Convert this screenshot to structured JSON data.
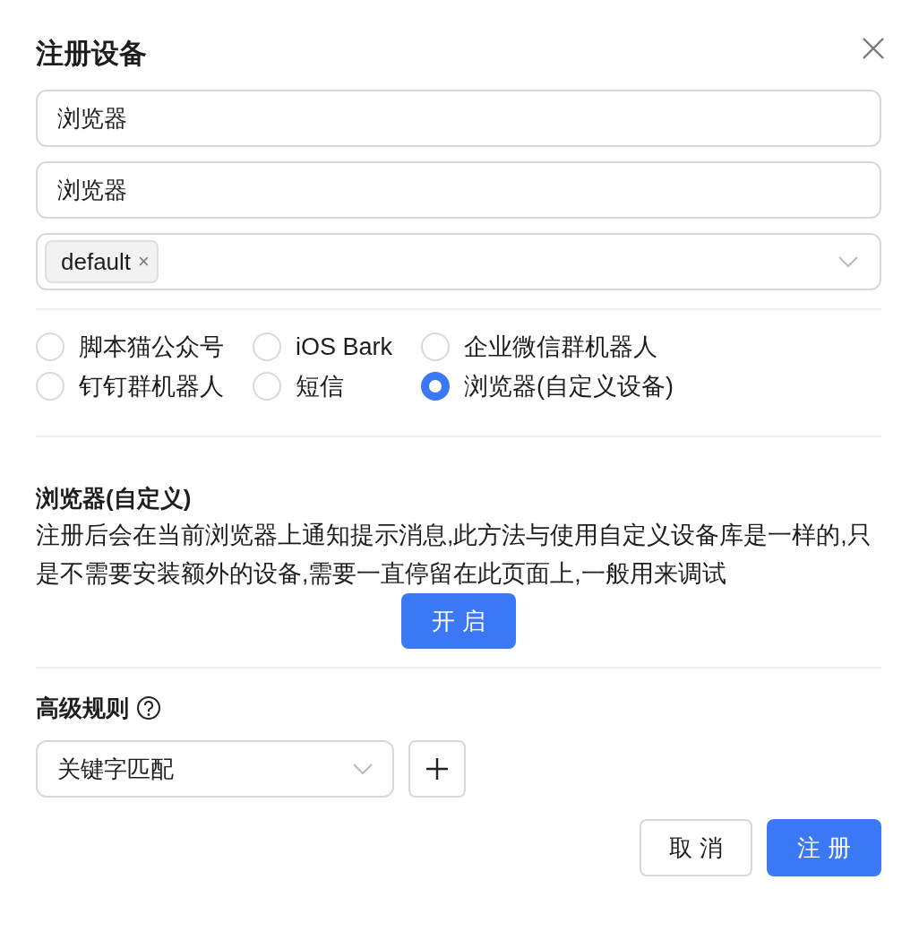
{
  "dialog": {
    "title": "注册设备"
  },
  "fields": [
    {
      "value": "浏览器"
    },
    {
      "value": "浏览器"
    }
  ],
  "tags_select": {
    "tags": [
      {
        "label": "default",
        "close": "×"
      }
    ]
  },
  "channels": [
    {
      "label": "脚本猫公众号",
      "selected": false
    },
    {
      "label": "iOS Bark",
      "selected": false
    },
    {
      "label": "企业微信群机器人",
      "selected": false
    },
    {
      "label": "钉钉群机器人",
      "selected": false
    },
    {
      "label": "短信",
      "selected": false
    },
    {
      "label": "浏览器(自定义设备)",
      "selected": true
    }
  ],
  "section": {
    "title": "浏览器(自定义)",
    "description": "注册后会在当前浏览器上通知提示消息,此方法与使用自定义设备库是一样的,只是不需要安装额外的设备,需要一直停留在此页面上,一般用来调试",
    "button": "开 启"
  },
  "advanced": {
    "title": "高级规则",
    "rule_select": "关键字匹配"
  },
  "footer": {
    "cancel": "取 消",
    "submit": "注 册"
  }
}
